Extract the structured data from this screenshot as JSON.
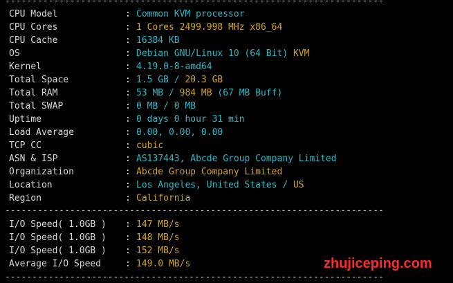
{
  "separator": "----------------------------------------------------------------------",
  "colon": ":",
  "system": [
    {
      "label": "CPU Model",
      "segments": [
        {
          "text": "Common KVM processor",
          "color": "cyan"
        }
      ]
    },
    {
      "label": "CPU Cores",
      "segments": [
        {
          "text": "1 Cores 2499.998 MHz x86_64",
          "color": "yellow"
        }
      ]
    },
    {
      "label": "CPU Cache",
      "segments": [
        {
          "text": "16384 KB",
          "color": "cyan"
        }
      ]
    },
    {
      "label": "OS",
      "segments": [
        {
          "text": "Debian GNU/Linux 10 (64 Bit) ",
          "color": "cyan"
        },
        {
          "text": "KVM",
          "color": "yellow"
        }
      ]
    },
    {
      "label": "Kernel",
      "segments": [
        {
          "text": "4.19.0-8-amd64",
          "color": "cyan"
        }
      ]
    },
    {
      "label": "Total Space",
      "segments": [
        {
          "text": "1.5 GB / ",
          "color": "cyan"
        },
        {
          "text": "20.3 GB",
          "color": "yellow"
        }
      ]
    },
    {
      "label": "Total RAM",
      "segments": [
        {
          "text": "53 MB / ",
          "color": "cyan"
        },
        {
          "text": "984 MB",
          "color": "yellow"
        },
        {
          "text": " (67 MB Buff)",
          "color": "cyan"
        }
      ]
    },
    {
      "label": "Total SWAP",
      "segments": [
        {
          "text": "0 MB / 0 MB",
          "color": "cyan"
        }
      ]
    },
    {
      "label": "Uptime",
      "segments": [
        {
          "text": "0 days 0 hour 31 min",
          "color": "cyan"
        }
      ]
    },
    {
      "label": "Load Average",
      "segments": [
        {
          "text": "0.00, 0.00, 0.00",
          "color": "cyan"
        }
      ]
    },
    {
      "label": "TCP CC",
      "segments": [
        {
          "text": "cubic",
          "color": "yellow"
        }
      ]
    },
    {
      "label": "ASN & ISP",
      "segments": [
        {
          "text": "AS137443, Abcde Group Company Limited",
          "color": "cyan"
        }
      ]
    },
    {
      "label": "Organization",
      "segments": [
        {
          "text": "Abcde Group Company Limited",
          "color": "yellow"
        }
      ]
    },
    {
      "label": "Location",
      "segments": [
        {
          "text": "Los Angeles, United States / ",
          "color": "cyan"
        },
        {
          "text": "US",
          "color": "yellow"
        }
      ]
    },
    {
      "label": "Region",
      "segments": [
        {
          "text": "California",
          "color": "yellow"
        }
      ]
    }
  ],
  "io": [
    {
      "label": "I/O Speed( 1.0GB )",
      "segments": [
        {
          "text": "147 MB/s",
          "color": "yellow"
        }
      ]
    },
    {
      "label": "I/O Speed( 1.0GB )",
      "segments": [
        {
          "text": "148 MB/s",
          "color": "yellow"
        }
      ]
    },
    {
      "label": "I/O Speed( 1.0GB )",
      "segments": [
        {
          "text": "152 MB/s",
          "color": "yellow"
        }
      ]
    },
    {
      "label": "Average I/O Speed",
      "segments": [
        {
          "text": "149.0 MB/s",
          "color": "yellow"
        }
      ]
    }
  ],
  "watermark": "zhujiceping.com",
  "colors": {
    "cyan": "#2ab7c4",
    "yellow": "#d2a41e",
    "label": "#d8d8d8",
    "watermark": "#ff2a2a",
    "background": "#000000"
  }
}
